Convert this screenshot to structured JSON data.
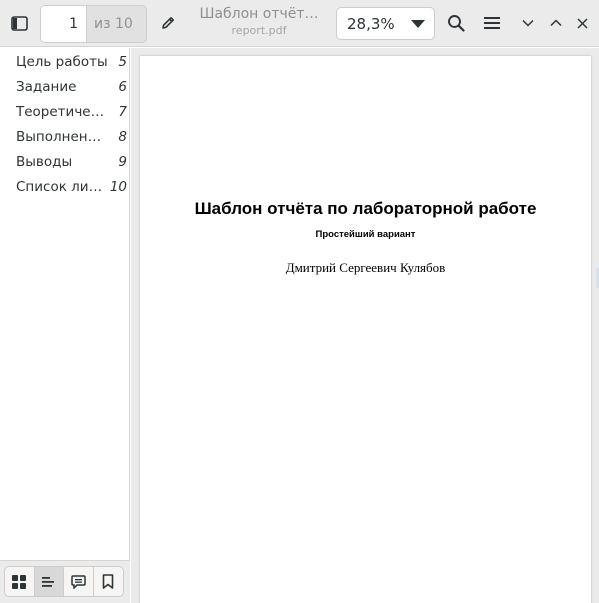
{
  "header": {
    "page_current": "1",
    "page_of": "из 10",
    "title": "Шаблон отчёт…",
    "filename": "report.pdf",
    "zoom": "28,3%",
    "icons": {
      "sidebar_toggle": "sidebar-toggle-icon",
      "annotate": "pencil-icon",
      "search": "search-icon",
      "menu": "hamburger-menu-icon",
      "minimize": "chevron-down-icon",
      "maximize": "chevron-up-icon",
      "close": "close-icon"
    }
  },
  "sidebar": {
    "toc": [
      {
        "label": "Цель работы",
        "page": "5"
      },
      {
        "label": "Задание",
        "page": "6"
      },
      {
        "label": "Теоретиче…",
        "page": "7"
      },
      {
        "label": "Выполнени…",
        "page": "8"
      },
      {
        "label": "Выводы",
        "page": "9"
      },
      {
        "label": "Список лит…",
        "page": "10"
      }
    ],
    "footer_tabs": [
      {
        "name": "thumbnails",
        "icon": "grid-icon",
        "active": false
      },
      {
        "name": "outline",
        "icon": "outline-icon",
        "active": true
      },
      {
        "name": "annotations",
        "icon": "comment-icon",
        "active": false
      },
      {
        "name": "bookmarks",
        "icon": "bookmark-icon",
        "active": false
      }
    ]
  },
  "document": {
    "title": "Шаблон отчёта по лабораторной работе",
    "subtitle": "Простейший вариант",
    "author": "Дмитрий Сергеевич Кулябов"
  },
  "colors": {
    "header_bg": "#ebebeb",
    "icon": "#2e3436",
    "muted_text": "#8c9092",
    "doc_bg": "#ebebeb"
  }
}
